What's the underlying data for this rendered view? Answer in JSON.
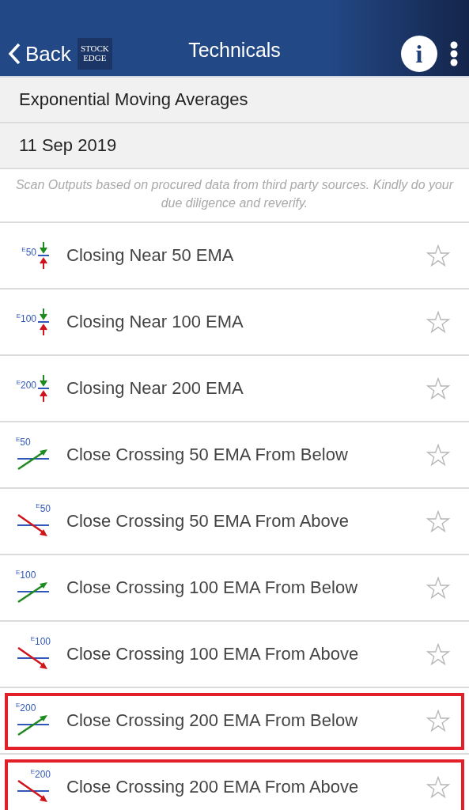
{
  "header": {
    "back": "Back",
    "logo": [
      "STOCK",
      "EDGE"
    ],
    "title": "Technicals",
    "info": "i"
  },
  "section": "Exponential Moving Averages",
  "date": "11 Sep 2019",
  "disclaimer": "Scan Outputs based on procured data from third party sources. Kindly do your due diligence and reverify.",
  "scans": [
    {
      "kind": "near",
      "icon_label": "$^{E}$50",
      "label": "Closing Near 50 EMA",
      "starred": false,
      "highlighted": false
    },
    {
      "kind": "near",
      "icon_label": "$^{E}$100",
      "label": "Closing Near 100 EMA",
      "starred": false,
      "highlighted": false
    },
    {
      "kind": "near",
      "icon_label": "$^{E}$200",
      "label": "Closing Near 200 EMA",
      "starred": false,
      "highlighted": false
    },
    {
      "kind": "cross_up",
      "icon_label": "$^{E}$50",
      "label": "Close Crossing 50 EMA From Below",
      "starred": false,
      "highlighted": false
    },
    {
      "kind": "cross_down",
      "icon_label": "$^{E}$50",
      "label": "Close Crossing 50 EMA From Above",
      "starred": false,
      "highlighted": false
    },
    {
      "kind": "cross_up",
      "icon_label": "$^{E}$100",
      "label": "Close Crossing 100 EMA From Below",
      "starred": false,
      "highlighted": false
    },
    {
      "kind": "cross_down",
      "icon_label": "$^{E}$100",
      "label": "Close Crossing 100 EMA From Above",
      "starred": false,
      "highlighted": false
    },
    {
      "kind": "cross_up",
      "icon_label": "$^{E}$200",
      "label": "Close Crossing 200 EMA From Below",
      "starred": false,
      "highlighted": true
    },
    {
      "kind": "cross_down",
      "icon_label": "$^{E}$200",
      "label": "Close Crossing 200 EMA From Above",
      "starred": false,
      "highlighted": true
    }
  ]
}
